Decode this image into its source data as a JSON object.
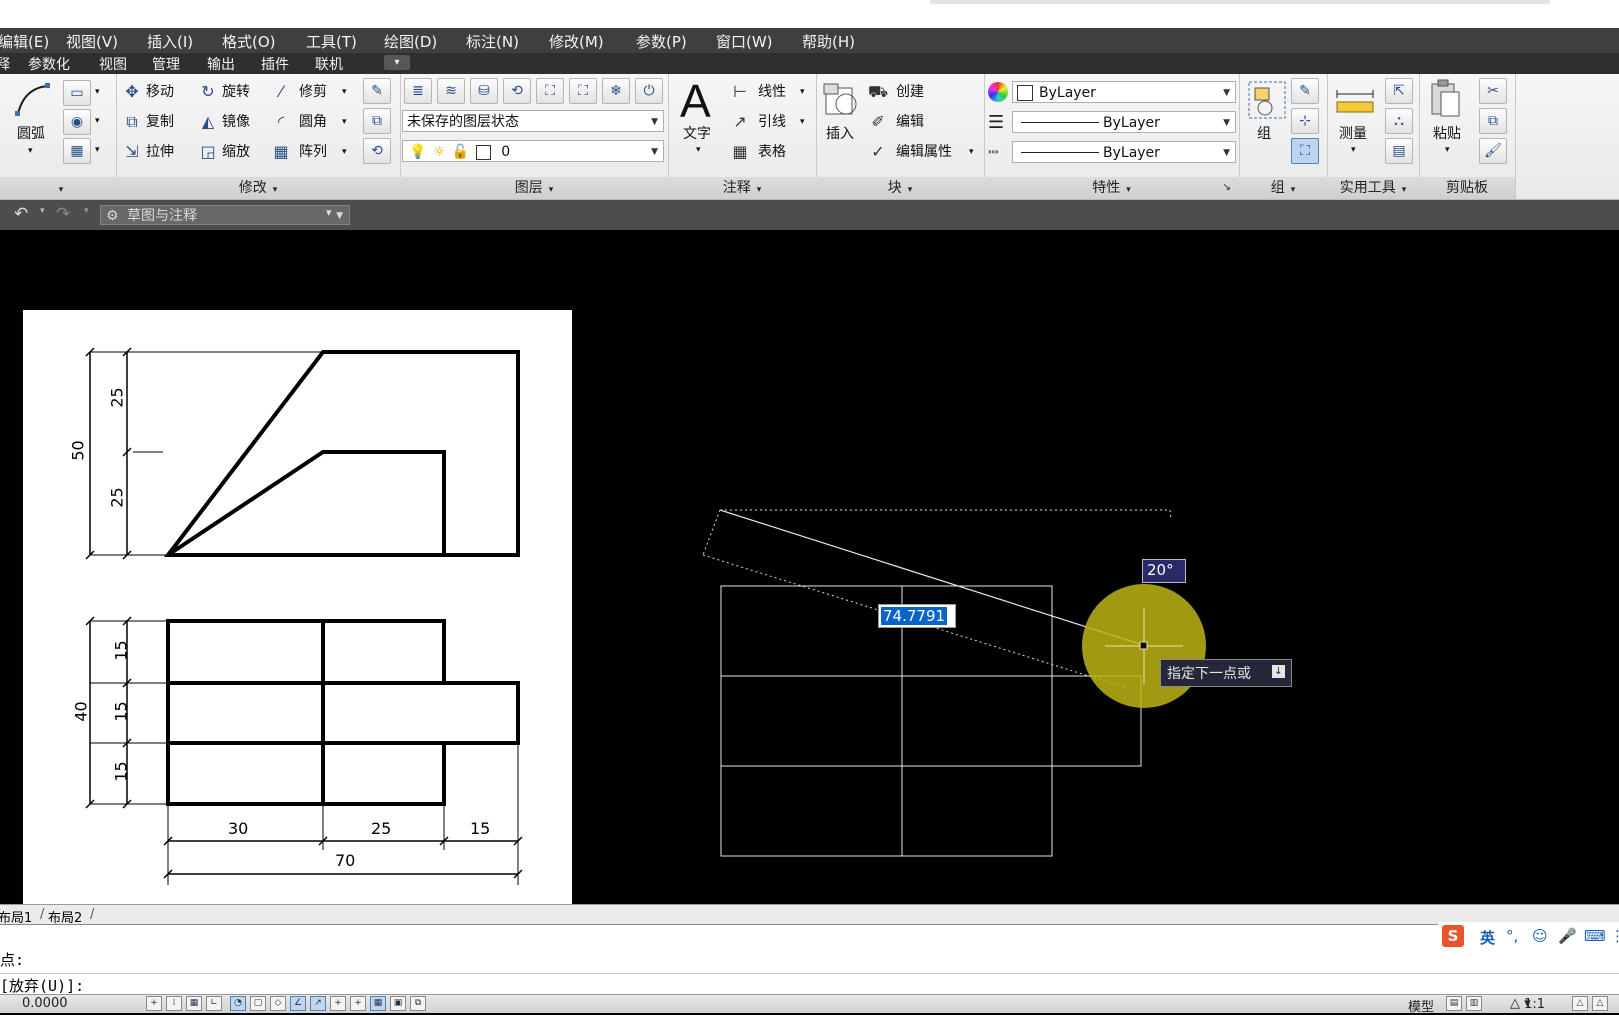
{
  "menu": [
    "编辑(E)",
    "视图(V)",
    "插入(I)",
    "格式(O)",
    "工具(T)",
    "绘图(D)",
    "标注(N)",
    "修改(M)",
    "参数(P)",
    "窗口(W)",
    "帮助(H)"
  ],
  "tabs": [
    "释",
    "参数化",
    "视图",
    "管理",
    "输出",
    "插件",
    "联机"
  ],
  "draw_panel": {
    "arc": "圆弧"
  },
  "modify_panel": {
    "title": "修改",
    "move": "移动",
    "rotate": "旋转",
    "trim": "修剪",
    "copy": "复制",
    "mirror": "镜像",
    "fillet": "圆角",
    "stretch": "拉伸",
    "scale": "缩放",
    "array": "阵列"
  },
  "layer_panel": {
    "title": "图层",
    "state": "未保存的图层状态",
    "current_layer": "0"
  },
  "annotation_panel": {
    "title": "注释",
    "text": "文字",
    "linear": "线性",
    "leader": "引线",
    "table": "表格"
  },
  "block_panel": {
    "title": "块",
    "insert": "插入",
    "create": "创建",
    "edit": "编辑",
    "edit_attr": "编辑属性"
  },
  "properties_panel": {
    "title": "特性",
    "color": "ByLayer",
    "linetype": "ByLayer",
    "lineweight": "ByLayer"
  },
  "group_panel": {
    "title": "组",
    "group": "组"
  },
  "utilities_panel": {
    "title": "实用工具",
    "measure": "测量"
  },
  "clipboard_panel": {
    "title": "剪贴板",
    "paste": "粘贴"
  },
  "workspace": "草图与注释",
  "reference_drawing": {
    "front_view": {
      "dims_v": [
        "25",
        "25"
      ],
      "overall_v": "50"
    },
    "top_view": {
      "dims_v": [
        "15",
        "15",
        "15"
      ],
      "overall_v": "40",
      "dims_h": [
        "30",
        "25",
        "15"
      ],
      "overall_h": "70"
    }
  },
  "dynamic_input": {
    "length": "74.7791",
    "angle": "20°",
    "prompt": "指定下一点或"
  },
  "layout_tabs": [
    "布局1",
    "布局2"
  ],
  "command_lines": [
    "点:",
    "[放弃(U)]:"
  ],
  "status": {
    "coords": "0.0000",
    "model": "模型",
    "scale": "1:1"
  },
  "ime": {
    "lang": "英",
    "punct": "°,"
  },
  "colors": {
    "menubar": "#3f3f3f",
    "canvas": "#000000",
    "highlight": "#0a64c8",
    "cursor_circle": "#bdb415"
  }
}
